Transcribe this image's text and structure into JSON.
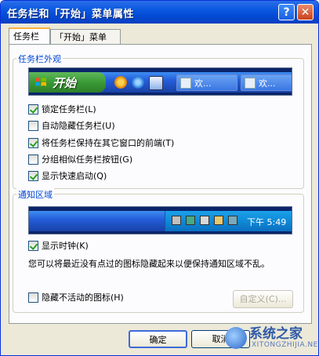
{
  "window": {
    "title": "任务栏和「开始」菜单属性"
  },
  "titlebar_buttons": {
    "help": "?",
    "close": "✕"
  },
  "tabs": [
    {
      "label": "任务栏",
      "active": true
    },
    {
      "label": "「开始」菜单",
      "active": false
    }
  ],
  "appearance": {
    "group_label": "任务栏外观",
    "preview": {
      "start_label": "开始",
      "quicklaunch_icons": [
        "media-player-icon",
        "ie-icon",
        "outlook-icon"
      ],
      "task_buttons": [
        "欢...",
        "欢..."
      ]
    },
    "options": [
      {
        "label": "锁定任务栏(L)",
        "checked": true
      },
      {
        "label": "自动隐藏任务栏(U)",
        "checked": false
      },
      {
        "label": "将任务栏保持在其它窗口的前端(T)",
        "checked": true
      },
      {
        "label": "分组相似任务栏按钮(G)",
        "checked": false
      },
      {
        "label": "显示快速启动(Q)",
        "checked": true
      }
    ]
  },
  "notification": {
    "group_label": "通知区域",
    "clock": "下午 5:49",
    "show_clock": {
      "label": "显示时钟(K)",
      "checked": true
    },
    "description": "您可以将最近没有点过的图标隐藏起来以便保持通知区域不乱。",
    "hide_inactive": {
      "label": "隐藏不活动的图标(H)",
      "checked": false
    },
    "customize_label": "自定义(C)..."
  },
  "footer": {
    "ok_label": "确定",
    "cancel_label": "取消"
  },
  "watermark": {
    "brand": "系统之家",
    "url": "XITONGZHIJIA.NET"
  },
  "colors": {
    "titlebar": "#0349d2",
    "dialog_bg": "#ece9d8",
    "group_label": "#0046d5",
    "start_button": "#3a9a36"
  }
}
